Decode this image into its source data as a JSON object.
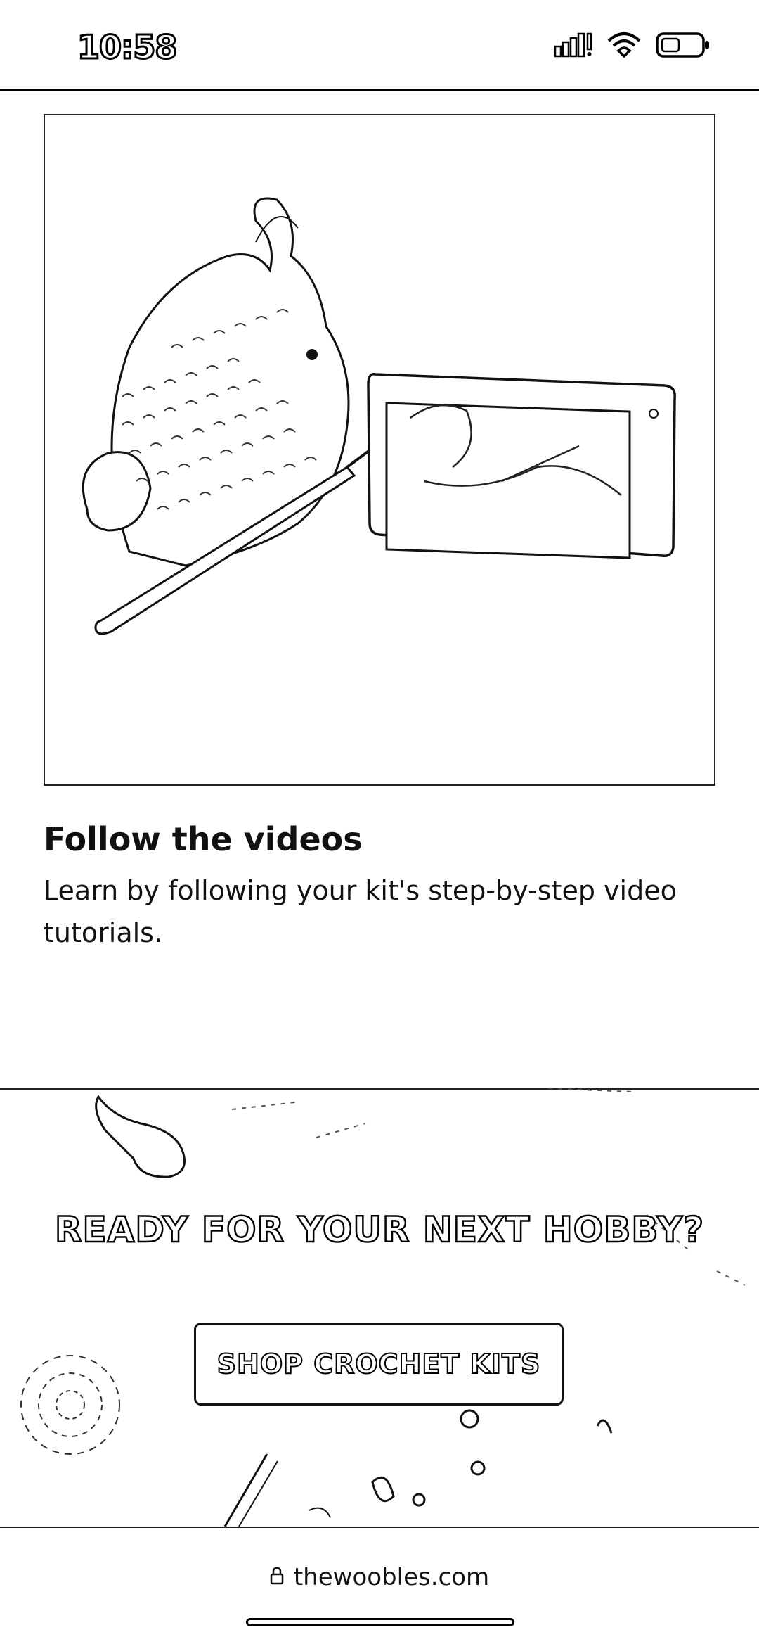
{
  "status_bar": {
    "time": "10:58",
    "icons": [
      "signal-icon",
      "wifi-icon",
      "battery-icon"
    ]
  },
  "hero": {
    "icons": [
      "crochet-toy-image",
      "crochet-hook-image",
      "phone-video-image"
    ]
  },
  "content": {
    "heading": "Follow the videos",
    "body": "Learn by following your kit's step-by-step video tutorials."
  },
  "promo": {
    "title": "READY FOR YOUR NEXT HOBBY?",
    "button_label": "SHOP CROCHET KITS"
  },
  "browser": {
    "url": "thewoobles.com",
    "icons": [
      "lock-icon"
    ]
  },
  "colors": {
    "background": "#ffffff",
    "ink": "#111111"
  }
}
